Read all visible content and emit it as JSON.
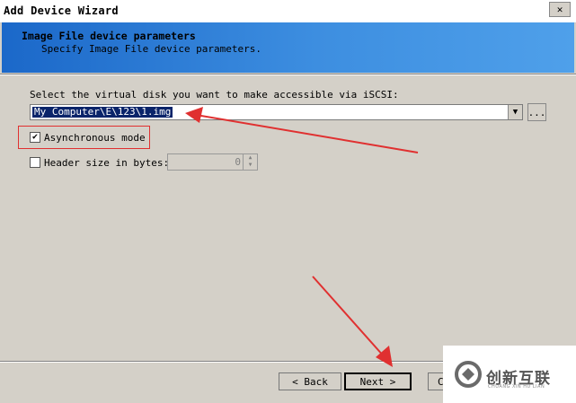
{
  "window": {
    "title": "Add Device Wizard",
    "close_glyph": "✕"
  },
  "header": {
    "title": "Image File device parameters",
    "subtitle": "Specify Image File device parameters."
  },
  "form": {
    "disk_prompt": "Select the virtual disk you want to make accessible via iSCSI:",
    "disk_value": "My Computer\\E\\123\\1.img",
    "browse_label": "...",
    "async_label": "Asynchronous mode",
    "async_checked": true,
    "header_size_label": "Header size in bytes:",
    "header_size_checked": false,
    "header_size_value": "0"
  },
  "buttons": {
    "back": "< Back",
    "next": "Next >",
    "cancel": "C"
  },
  "watermark": {
    "name": "创新互联",
    "subtitle": "CHUANG XIN HU LIAN"
  },
  "colors": {
    "annotation_red": "#e03030",
    "header_blue": "#1b68c9",
    "selection": "#0a246a"
  },
  "icons": [
    "close-icon",
    "dropdown-arrow-icon",
    "checkmark-icon",
    "spin-up-icon",
    "spin-down-icon",
    "logo-icon",
    "arrow-annotation"
  ]
}
